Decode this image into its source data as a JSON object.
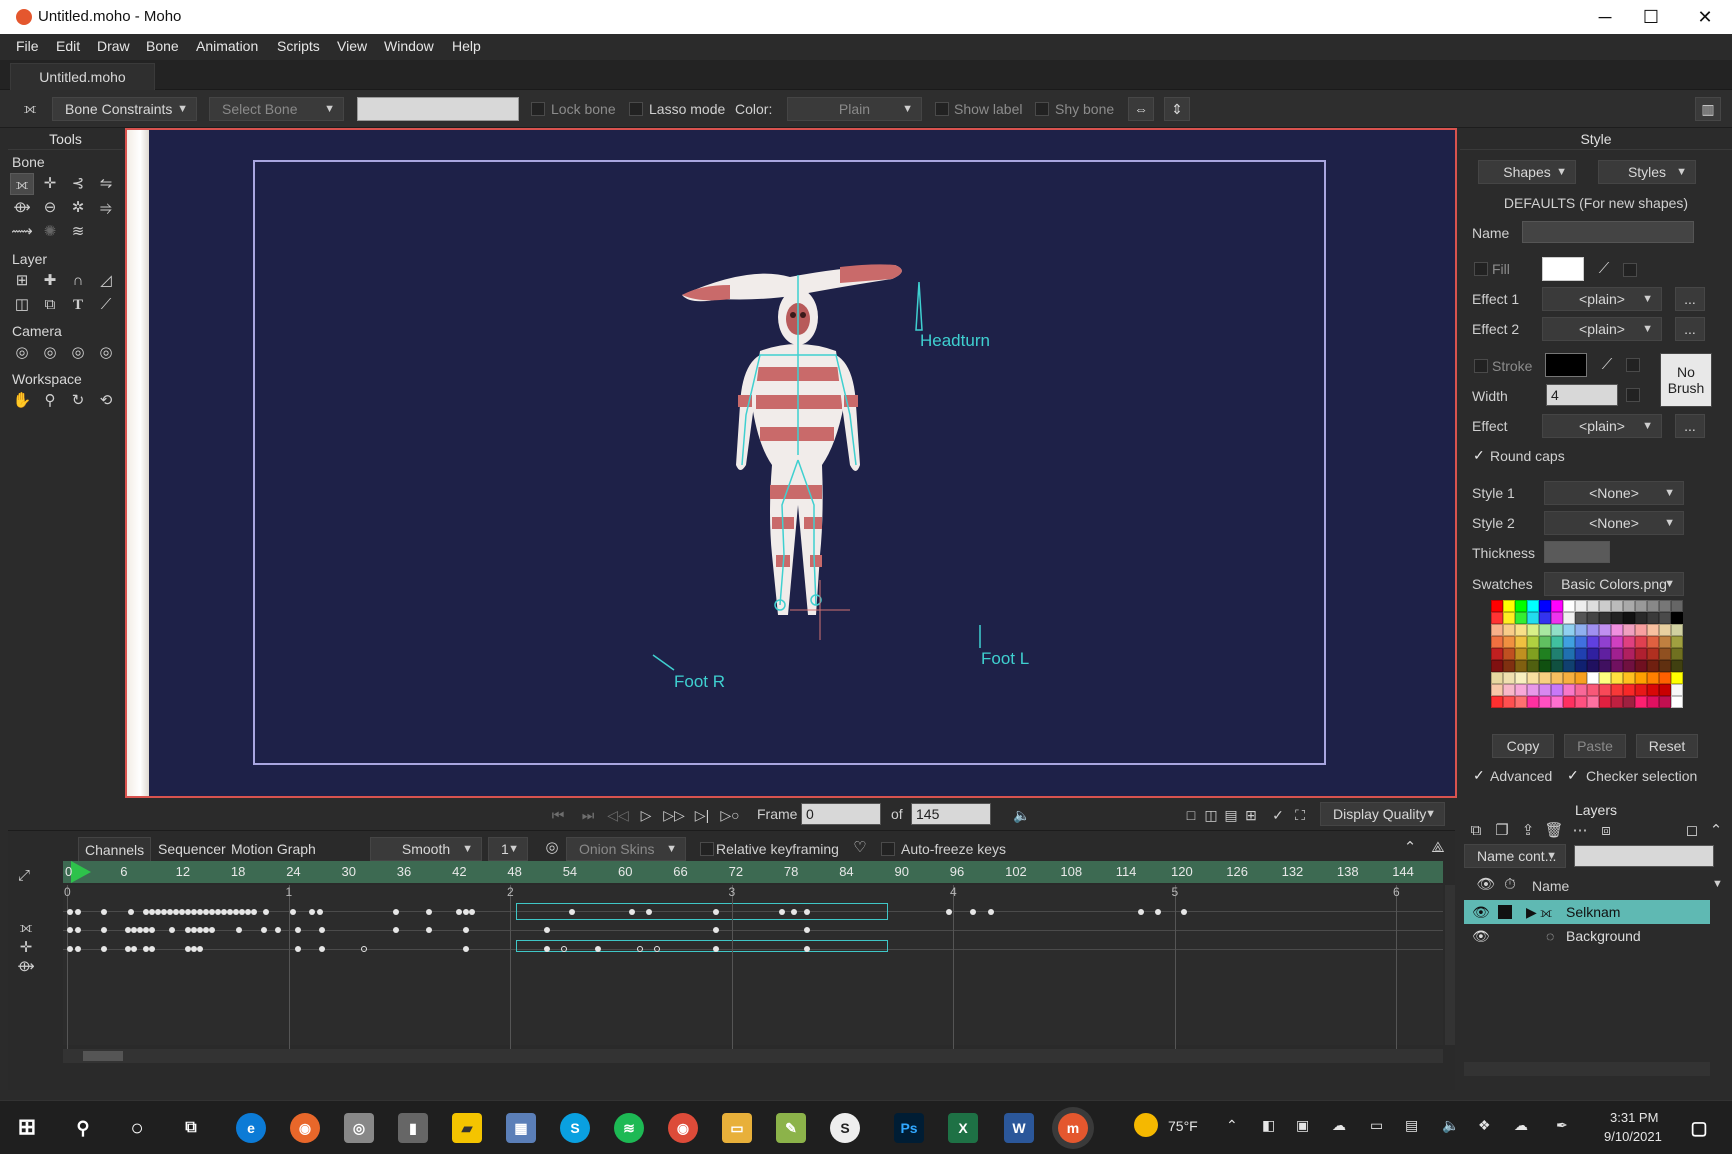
{
  "window": {
    "title": "Untitled.moho - Moho",
    "minimize": "─",
    "maximize": "☐",
    "close": "✕"
  },
  "menu": [
    "File",
    "Edit",
    "Draw",
    "Bone",
    "Animation",
    "Scripts",
    "View",
    "Window",
    "Help"
  ],
  "doc_tab": "Untitled.moho",
  "options": {
    "bone_constraints": "Bone Constraints",
    "select_bone": "Select Bone",
    "lock_bone": "Lock bone",
    "lasso_mode": "Lasso mode",
    "color_label": "Color:",
    "color_value": "Plain",
    "show_label": "Show label",
    "shy_bone": "Shy bone"
  },
  "tools": {
    "title": "Tools",
    "sections": [
      "Bone",
      "Layer",
      "Camera",
      "Workspace"
    ]
  },
  "canvas": {
    "bone_labels": {
      "headturn": "Headturn",
      "foot_r": "Foot R",
      "foot_l": "Foot L"
    },
    "background": "#1e2148"
  },
  "style": {
    "title": "Style",
    "shapes": "Shapes",
    "styles": "Styles",
    "defaults": "DEFAULTS (For new shapes)",
    "name_label": "Name",
    "fill_label": "Fill",
    "effect1_label": "Effect 1",
    "effect1_value": "<plain>",
    "effect2_label": "Effect 2",
    "effect2_value": "<plain>",
    "stroke_label": "Stroke",
    "no_brush_1": "No",
    "no_brush_2": "Brush",
    "width_label": "Width",
    "width_value": "4",
    "effect_label": "Effect",
    "effect_value": "<plain>",
    "round_caps": "Round caps",
    "style1_label": "Style 1",
    "style1_value": "<None>",
    "style2_label": "Style 2",
    "style2_value": "<None>",
    "thickness_label": "Thickness",
    "swatches_label": "Swatches",
    "swatches_value": "Basic Colors.png",
    "copy": "Copy",
    "paste": "Paste",
    "reset": "Reset",
    "advanced": "Advanced",
    "checker_selection": "Checker selection",
    "more": "..."
  },
  "transport": {
    "frame_label": "Frame",
    "frame_value": "0",
    "of_label": "of",
    "total_frames": "145",
    "display_quality": "Display Quality"
  },
  "timeline": {
    "tabs": [
      "Channels",
      "Sequencer",
      "Motion Graph"
    ],
    "interp": "Smooth",
    "interp_num": "1",
    "onion_skins": "Onion Skins",
    "relative_keyframing": "Relative keyframing",
    "auto_freeze": "Auto-freeze keys",
    "ruler": [
      "0",
      "6",
      "12",
      "18",
      "24",
      "30",
      "36",
      "42",
      "48",
      "54",
      "60",
      "66",
      "72",
      "78",
      "84",
      "90",
      "96",
      "102",
      "108",
      "114",
      "120",
      "126",
      "132",
      "138",
      "144"
    ],
    "seconds": [
      "0",
      "1",
      "2",
      "3",
      "4",
      "5",
      "6"
    ]
  },
  "layers": {
    "title": "Layers",
    "filter": "Name cont...",
    "name_col": "Name",
    "items": [
      "Selknam",
      "Background"
    ]
  },
  "taskbar": {
    "weather": "75°F",
    "time": "3:31 PM",
    "date": "9/10/2021"
  }
}
